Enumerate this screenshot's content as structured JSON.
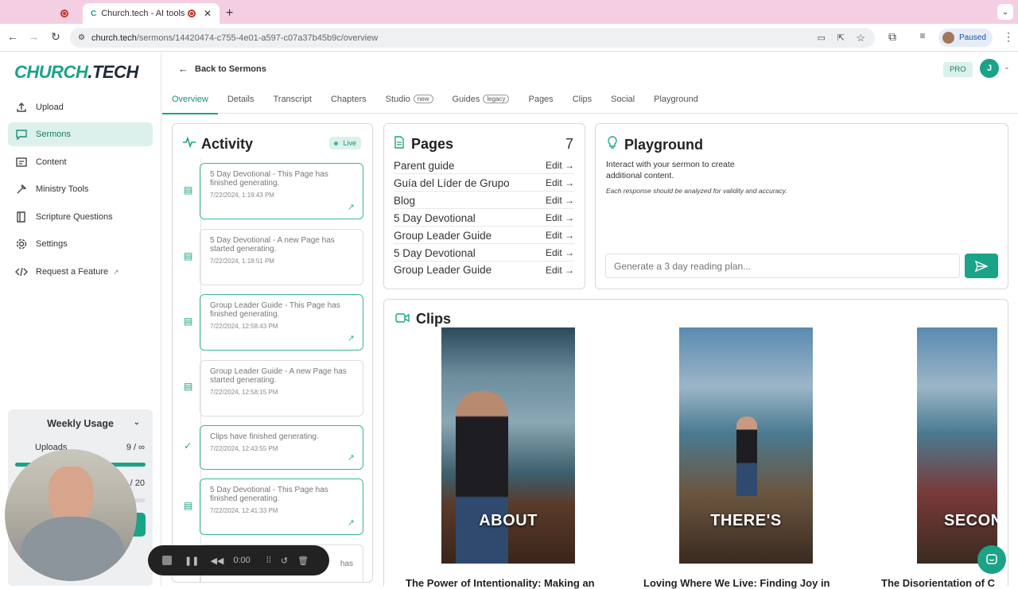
{
  "browser": {
    "tab_title": "Church.tech - AI tools tha",
    "url_host": "church.tech",
    "url_path": "/sermons/14420474-c755-4e01-a597-c07a37b45b9c/overview",
    "profile_status": "Paused"
  },
  "sidebar": {
    "logo_main": "CHURCH",
    "logo_dot": ".TECH",
    "items": [
      {
        "label": "Upload",
        "icon": "upload-icon"
      },
      {
        "label": "Sermons",
        "icon": "sermon-chat-icon"
      },
      {
        "label": "Content",
        "icon": "content-icon"
      },
      {
        "label": "Ministry Tools",
        "icon": "tools-icon"
      },
      {
        "label": "Scripture Questions",
        "icon": "book-icon"
      },
      {
        "label": "Settings",
        "icon": "gear-icon"
      },
      {
        "label": "Request a Feature",
        "icon": "code-icon"
      }
    ],
    "usage": {
      "title": "Weekly Usage",
      "uploads_label": "Uploads",
      "uploads_value": "9 / ∞",
      "second_value": "/ 20"
    }
  },
  "header": {
    "back_label": "Back to Sermons",
    "plan_badge": "PRO",
    "avatar_initial": "J"
  },
  "tabs": [
    {
      "label": "Overview"
    },
    {
      "label": "Details"
    },
    {
      "label": "Transcript"
    },
    {
      "label": "Chapters"
    },
    {
      "label": "Studio",
      "pill": "new"
    },
    {
      "label": "Guides",
      "pill": "legacy"
    },
    {
      "label": "Pages"
    },
    {
      "label": "Clips"
    },
    {
      "label": "Social"
    },
    {
      "label": "Playground"
    }
  ],
  "activity": {
    "title": "Activity",
    "status": "Live",
    "items": [
      {
        "text": "5 Day Devotional - This Page has finished generating.",
        "time": "7/22/2024, 1:19:43 PM",
        "state": "done"
      },
      {
        "text": "5 Day Devotional - A new Page has started generating.",
        "time": "7/22/2024, 1:18:51 PM",
        "state": "pending"
      },
      {
        "text": "Group Leader Guide - This Page has finished generating.",
        "time": "7/22/2024, 12:58:43 PM",
        "state": "done"
      },
      {
        "text": "Group Leader Guide - A new Page has started generating.",
        "time": "7/22/2024, 12:58:15 PM",
        "state": "pending"
      },
      {
        "text": "Clips have finished generating.",
        "time": "7/22/2024, 12:43:55 PM",
        "state": "done"
      },
      {
        "text": "5 Day Devotional - This Page has finished generating.",
        "time": "7/22/2024, 12:41:33 PM",
        "state": "done"
      },
      {
        "text": "has",
        "time": "",
        "state": "pending"
      }
    ]
  },
  "pages": {
    "title": "Pages",
    "count": "7",
    "edit_label": "Edit",
    "items": [
      "Parent guide",
      "Guía del Líder de Grupo",
      "Blog",
      "5 Day Devotional",
      "Group Leader Guide",
      "5 Day Devotional",
      "Group Leader Guide"
    ]
  },
  "playground": {
    "title": "Playground",
    "description": "Interact with your sermon to create additional content.",
    "note": "Each response should be analyzed for validity and accuracy.",
    "placeholder": "Generate a 3 day reading plan..."
  },
  "clips": {
    "title": "Clips",
    "items": [
      {
        "caption": "ABOUT",
        "title": "The Power of Intentionality: Making an"
      },
      {
        "caption": "THERE'S",
        "title": "Loving Where We Live: Finding Joy in"
      },
      {
        "caption": "SECON",
        "title": "The Disorientation of C"
      }
    ]
  },
  "recorder": {
    "time": "0:00"
  }
}
